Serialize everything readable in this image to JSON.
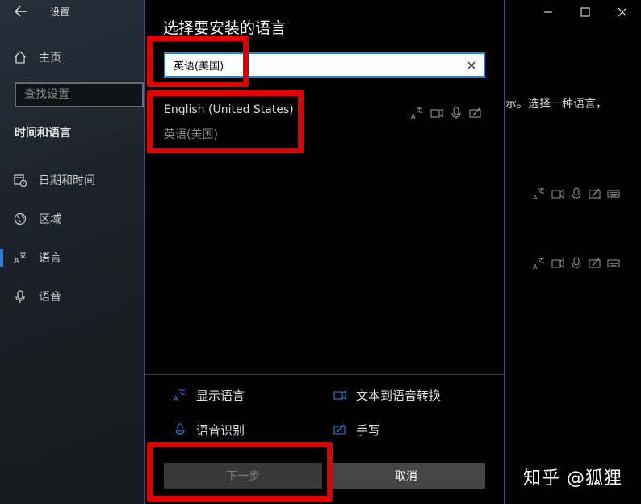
{
  "app": {
    "title": "设置",
    "window_controls": [
      "minimize-icon",
      "maximize-icon",
      "close-icon"
    ]
  },
  "sidebar": {
    "home_label": "主页",
    "search_placeholder": "查找设置",
    "section_heading": "时间和语言",
    "items": [
      {
        "label": "日期和时间",
        "icon": "calendar-clock-icon"
      },
      {
        "label": "区域",
        "icon": "globe-icon"
      },
      {
        "label": "语言",
        "icon": "language-icon",
        "active": true
      },
      {
        "label": "语音",
        "icon": "microphone-icon"
      }
    ]
  },
  "background": {
    "hint_text": "示。选择一种语言，",
    "capability_icons": [
      "display-language-icon",
      "tts-icon",
      "speech-icon",
      "handwriting-icon",
      "keyboard-icon"
    ]
  },
  "dialog": {
    "title": "选择要安装的语言",
    "search_value": "英语(美国)",
    "result": {
      "name": "English (United States)",
      "native": "英语(美国)",
      "icons": [
        "display-language-icon",
        "tts-icon",
        "speech-icon",
        "handwriting-icon"
      ]
    },
    "features": [
      {
        "label": "显示语言",
        "icon": "display-language-icon"
      },
      {
        "label": "文本到语音转换",
        "icon": "tts-icon"
      },
      {
        "label": "语音识别",
        "icon": "speech-icon"
      },
      {
        "label": "手写",
        "icon": "handwriting-icon"
      }
    ],
    "next_label": "下一步",
    "cancel_label": "取消"
  },
  "watermark": "知乎 @狐狸",
  "colors": {
    "accent": "#2d7fd3",
    "highlight": "#e00000",
    "dialog_border": "#3f4b8c"
  }
}
